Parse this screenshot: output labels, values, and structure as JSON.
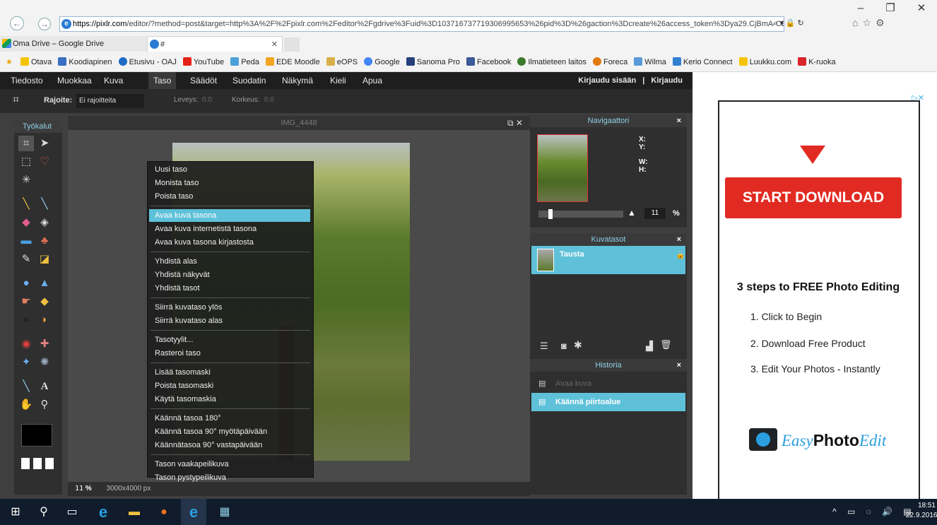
{
  "browser": {
    "url_host": "https://pixlr.com",
    "url_rest": "/editor/?method=post&target=http%3A%2F%2Fpixlr.com%2Feditor%2Fgdrive%3Fuid%3D103716737719306995653%26pid%3D%26gaction%3Dcreate%26access_token%3Dya29.CjBmA-CBcK",
    "tabs": [
      {
        "label": "Oma Drive – Google Drive"
      },
      {
        "label": "#"
      }
    ],
    "favorites": [
      "Otava",
      "Koodiapinen",
      "Etusivu - OAJ",
      "YouTube",
      "Peda",
      "EDE Moodle",
      "eOPS",
      "Google",
      "Sanoma Pro",
      "Facebook",
      "Ilmatieteen laitos",
      "Foreca",
      "Wilma",
      "Kerio Connect",
      "Luukku.com",
      "K-ruoka"
    ]
  },
  "menubar": {
    "items": [
      "Tiedosto",
      "Muokkaa",
      "Kuva",
      "Taso",
      "Säädöt",
      "Suodatin",
      "Näkymä",
      "Kieli",
      "Apua"
    ],
    "login": "Kirjaudu sisään",
    "signup": "Kirjaudu"
  },
  "options": {
    "constraint_label": "Rajoite:",
    "constraint_value": "Ei rajoitteita",
    "width_label": "Leveys:",
    "width_value": "0.0",
    "height_label": "Korkeus:",
    "height_value": "0.0"
  },
  "toolbox": {
    "title": "Työkalut"
  },
  "dropdown": {
    "items": [
      "Uusi taso",
      "Monista taso",
      "Poista taso",
      "Avaa kuva tasona",
      "Avaa kuva internetistä tasona",
      "Avaa kuva tasona kirjastosta",
      "Yhdistä alas",
      "Yhdistä näkyvät",
      "Yhdistä tasot",
      "Siirrä kuvataso ylös",
      "Siirrä kuvataso alas",
      "Tasotyylit...",
      "Rasteroi taso",
      "Lisää tasomaski",
      "Poista tasomaski",
      "Käytä tasomaskia",
      "Käännä tasoa 180°",
      "Käännä tasoa 90° myötäpäivään",
      "Käännätasoa 90° vastapäivään",
      "Tason vaakapeilikuva",
      "Tason pystypeilikuva"
    ],
    "highlighted": "Avaa kuva tasona"
  },
  "canvas": {
    "title": "IMG_4448",
    "zoom": "11",
    "zoom_unit": "%",
    "size": "3000x4000 px"
  },
  "navigator": {
    "title": "Navigaattori",
    "x_label": "X:",
    "y_label": "Y:",
    "w_label": "W:",
    "h_label": "H:",
    "zoom": "11",
    "zoom_unit": "%"
  },
  "layers": {
    "title": "Kuvatasot",
    "items": [
      "Tausta"
    ]
  },
  "history": {
    "title": "Historia",
    "items": [
      "Avaa kuva",
      "Käännä piirtoalue"
    ]
  },
  "ad": {
    "button": "START DOWNLOAD",
    "heading": "3 steps to FREE Photo Editing",
    "steps": [
      "1. Click to Begin",
      "2. Download Free Product",
      "3. Edit Your Photos - Instantly"
    ],
    "brand_a": "Easy",
    "brand_b": "Photo",
    "brand_c": "Edit"
  },
  "taskbar": {
    "time": "18:51",
    "date": "22.9.2016"
  },
  "colors": {
    "accent": "#5ec1d9",
    "ad_red": "#e12b22",
    "app_bg": "#3f3f3f"
  }
}
